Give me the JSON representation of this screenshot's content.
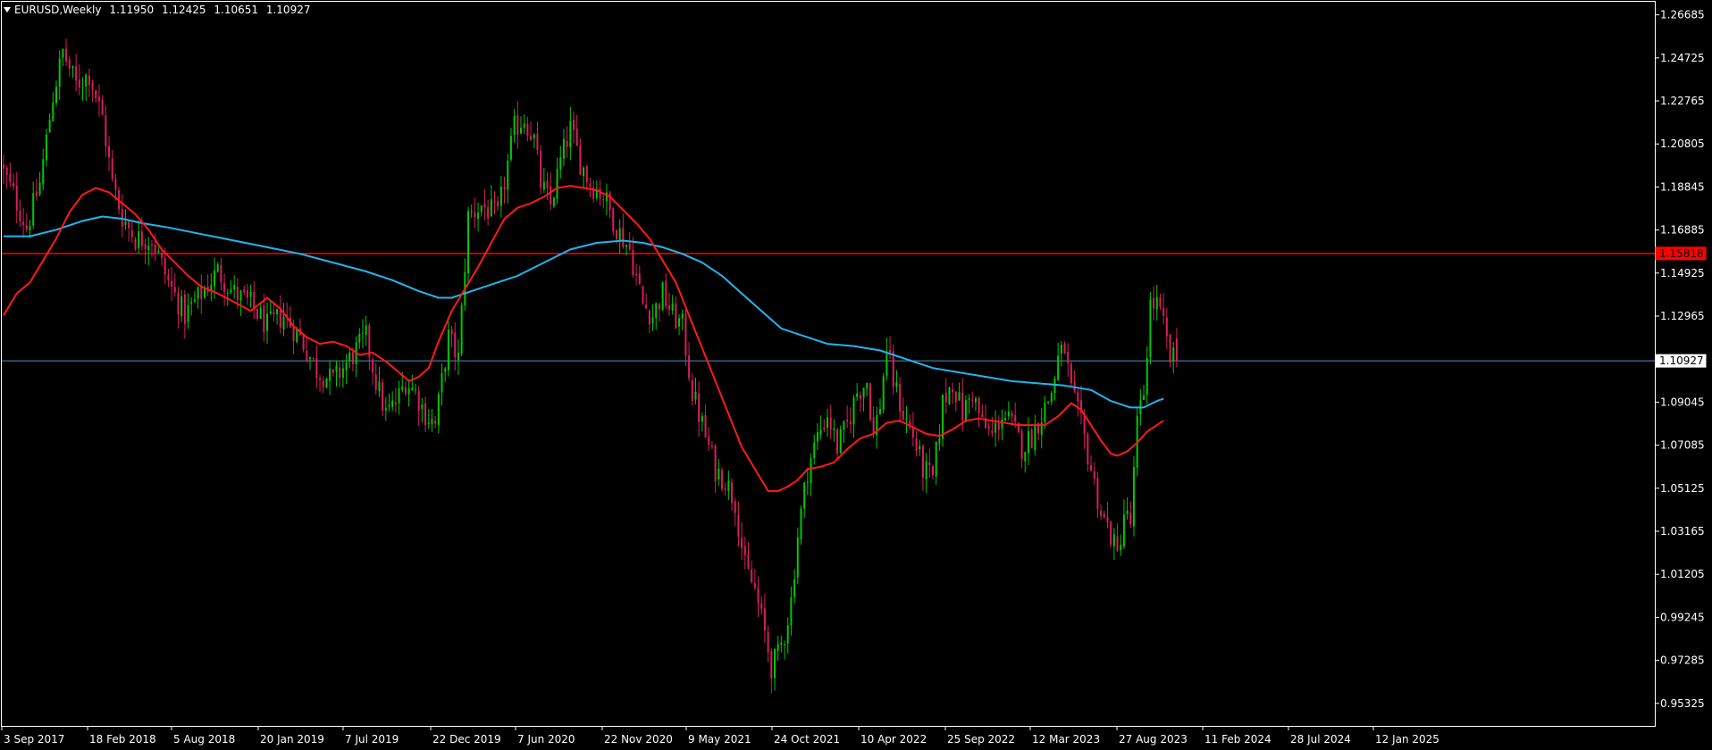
{
  "header": {
    "symbol_tf": "EURUSD,Weekly",
    "open": "1.11950",
    "high": "1.12425",
    "low": "1.10651",
    "close": "1.10927"
  },
  "colors": {
    "background": "#000000",
    "frame": "#ffffff",
    "bull": "#00c800",
    "bear": "#d81e5b",
    "ma_fast": "#ff1a1a",
    "ma_slow": "#22b5ec",
    "hline_red": "#ff0000",
    "hline_current": "#4f8fc0",
    "text": "#ffffff"
  },
  "chart_data": {
    "type": "candlestick",
    "symbol": "EURUSD",
    "timeframe": "Weekly",
    "ylim": [
      0.943,
      1.2728
    ],
    "y_ticks": [
      "1.26685",
      "1.24725",
      "1.22765",
      "1.20805",
      "1.18845",
      "1.16885",
      "1.14925",
      "1.12965",
      "1.11005",
      "1.09045",
      "1.07085",
      "1.05125",
      "1.03165",
      "1.01205",
      "0.99245",
      "0.97285",
      "0.95325"
    ],
    "x_ticks": [
      "3 Sep 2017",
      "18 Feb 2018",
      "5 Aug 2018",
      "20 Jan 2019",
      "7 Jul 2019",
      "22 Dec 2019",
      "7 Jun 2020",
      "22 Nov 2020",
      "9 May 2021",
      "24 Oct 2021",
      "10 Apr 2022",
      "25 Sep 2022",
      "12 Mar 2023",
      "27 Aug 2023",
      "11 Feb 2024",
      "28 Jul 2024",
      "12 Jan 2025"
    ],
    "horizontal_lines": [
      {
        "value": 1.15818,
        "label": "1.15818",
        "color": "#ff0000"
      },
      {
        "value": 1.10927,
        "label": "1.10927",
        "color": "#4f8fc0"
      }
    ],
    "close_anchors": [
      [
        0,
        1.195
      ],
      [
        3,
        1.185
      ],
      [
        7,
        1.17
      ],
      [
        11,
        1.19
      ],
      [
        15,
        1.23
      ],
      [
        18,
        1.25
      ],
      [
        22,
        1.235
      ],
      [
        26,
        1.24
      ],
      [
        30,
        1.22
      ],
      [
        33,
        1.19
      ],
      [
        36,
        1.175
      ],
      [
        40,
        1.165
      ],
      [
        45,
        1.165
      ],
      [
        50,
        1.145
      ],
      [
        55,
        1.13
      ],
      [
        60,
        1.14
      ],
      [
        65,
        1.15
      ],
      [
        70,
        1.14
      ],
      [
        75,
        1.135
      ],
      [
        80,
        1.125
      ],
      [
        85,
        1.13
      ],
      [
        90,
        1.12
      ],
      [
        95,
        1.105
      ],
      [
        100,
        1.1
      ],
      [
        105,
        1.11
      ],
      [
        110,
        1.12
      ],
      [
        113,
        1.1
      ],
      [
        116,
        1.085
      ],
      [
        119,
        1.09
      ],
      [
        122,
        1.1
      ],
      [
        125,
        1.095
      ],
      [
        128,
        1.085
      ],
      [
        131,
        1.08
      ],
      [
        135,
        1.12
      ],
      [
        138,
        1.11
      ],
      [
        141,
        1.175
      ],
      [
        145,
        1.18
      ],
      [
        150,
        1.175
      ],
      [
        155,
        1.215
      ],
      [
        158,
        1.22
      ],
      [
        161,
        1.21
      ],
      [
        163,
        1.19
      ],
      [
        166,
        1.18
      ],
      [
        169,
        1.2
      ],
      [
        172,
        1.215
      ],
      [
        175,
        1.2
      ],
      [
        178,
        1.19
      ],
      [
        182,
        1.185
      ],
      [
        186,
        1.17
      ],
      [
        190,
        1.16
      ],
      [
        194,
        1.135
      ],
      [
        197,
        1.13
      ],
      [
        200,
        1.14
      ],
      [
        203,
        1.13
      ],
      [
        206,
        1.125
      ],
      [
        209,
        1.095
      ],
      [
        213,
        1.075
      ],
      [
        216,
        1.06
      ],
      [
        219,
        1.055
      ],
      [
        222,
        1.045
      ],
      [
        225,
        1.015
      ],
      [
        228,
        1.005
      ],
      [
        231,
        0.985
      ],
      [
        233,
        0.97
      ],
      [
        235,
        0.975
      ],
      [
        237,
        0.985
      ],
      [
        239,
        1.0
      ],
      [
        241,
        1.03
      ],
      [
        244,
        1.06
      ],
      [
        247,
        1.075
      ],
      [
        250,
        1.085
      ],
      [
        253,
        1.07
      ],
      [
        256,
        1.08
      ],
      [
        259,
        1.095
      ],
      [
        262,
        1.1
      ],
      [
        264,
        1.075
      ],
      [
        266,
        1.09
      ],
      [
        268,
        1.115
      ],
      [
        270,
        1.1
      ],
      [
        273,
        1.085
      ],
      [
        276,
        1.075
      ],
      [
        279,
        1.06
      ],
      [
        282,
        1.055
      ],
      [
        285,
        1.09
      ],
      [
        288,
        1.1
      ],
      [
        291,
        1.085
      ],
      [
        294,
        1.095
      ],
      [
        297,
        1.08
      ],
      [
        300,
        1.075
      ],
      [
        303,
        1.085
      ],
      [
        306,
        1.08
      ],
      [
        309,
        1.07
      ],
      [
        312,
        1.075
      ],
      [
        315,
        1.085
      ],
      [
        318,
        1.095
      ],
      [
        320,
        1.11
      ],
      [
        322,
        1.115
      ],
      [
        324,
        1.095
      ],
      [
        327,
        1.08
      ],
      [
        330,
        1.06
      ],
      [
        333,
        1.04
      ],
      [
        336,
        1.03
      ],
      [
        338,
        1.02
      ],
      [
        340,
        1.04
      ],
      [
        342,
        1.035
      ],
      [
        344,
        1.08
      ],
      [
        346,
        1.095
      ],
      [
        348,
        1.135
      ],
      [
        350,
        1.135
      ],
      [
        352,
        1.125
      ],
      [
        354,
        1.11
      ]
    ],
    "ma_fast": {
      "name": "",
      "color": "#ff1a1a",
      "points": [
        [
          0,
          1.13
        ],
        [
          4,
          1.14
        ],
        [
          8,
          1.145
        ],
        [
          12,
          1.155
        ],
        [
          16,
          1.165
        ],
        [
          20,
          1.177
        ],
        [
          24,
          1.185
        ],
        [
          28,
          1.188
        ],
        [
          32,
          1.186
        ],
        [
          36,
          1.181
        ],
        [
          40,
          1.176
        ],
        [
          44,
          1.169
        ],
        [
          48,
          1.16
        ],
        [
          52,
          1.154
        ],
        [
          56,
          1.148
        ],
        [
          60,
          1.143
        ],
        [
          65,
          1.14
        ],
        [
          70,
          1.136
        ],
        [
          75,
          1.132
        ],
        [
          80,
          1.138
        ],
        [
          84,
          1.133
        ],
        [
          88,
          1.125
        ],
        [
          92,
          1.12
        ],
        [
          96,
          1.117
        ],
        [
          100,
          1.118
        ],
        [
          104,
          1.116
        ],
        [
          108,
          1.112
        ],
        [
          112,
          1.113
        ],
        [
          116,
          1.109
        ],
        [
          120,
          1.104
        ],
        [
          123,
          1.1
        ],
        [
          126,
          1.102
        ],
        [
          129,
          1.106
        ],
        [
          132,
          1.118
        ],
        [
          136,
          1.132
        ],
        [
          140,
          1.142
        ],
        [
          144,
          1.152
        ],
        [
          148,
          1.163
        ],
        [
          152,
          1.174
        ],
        [
          156,
          1.179
        ],
        [
          160,
          1.181
        ],
        [
          164,
          1.184
        ],
        [
          168,
          1.188
        ],
        [
          172,
          1.189
        ],
        [
          176,
          1.188
        ],
        [
          180,
          1.187
        ],
        [
          184,
          1.184
        ],
        [
          188,
          1.178
        ],
        [
          192,
          1.172
        ],
        [
          196,
          1.165
        ],
        [
          200,
          1.155
        ],
        [
          204,
          1.145
        ],
        [
          208,
          1.13
        ],
        [
          212,
          1.115
        ],
        [
          216,
          1.1
        ],
        [
          220,
          1.085
        ],
        [
          224,
          1.07
        ],
        [
          228,
          1.06
        ],
        [
          232,
          1.05
        ],
        [
          235,
          1.05
        ],
        [
          238,
          1.052
        ],
        [
          241,
          1.055
        ],
        [
          244,
          1.06
        ],
        [
          248,
          1.061
        ],
        [
          252,
          1.063
        ],
        [
          256,
          1.069
        ],
        [
          260,
          1.074
        ],
        [
          264,
          1.076
        ],
        [
          268,
          1.081
        ],
        [
          272,
          1.082
        ],
        [
          276,
          1.079
        ],
        [
          280,
          1.076
        ],
        [
          284,
          1.075
        ],
        [
          288,
          1.078
        ],
        [
          292,
          1.082
        ],
        [
          296,
          1.083
        ],
        [
          300,
          1.082
        ],
        [
          304,
          1.081
        ],
        [
          308,
          1.08
        ],
        [
          312,
          1.08
        ],
        [
          316,
          1.08
        ],
        [
          320,
          1.084
        ],
        [
          324,
          1.09
        ],
        [
          327,
          1.087
        ],
        [
          330,
          1.08
        ],
        [
          333,
          1.073
        ],
        [
          336,
          1.067
        ],
        [
          338,
          1.066
        ],
        [
          341,
          1.068
        ],
        [
          344,
          1.072
        ],
        [
          347,
          1.077
        ],
        [
          350,
          1.08
        ],
        [
          352,
          1.082
        ]
      ]
    },
    "ma_slow": {
      "name": "",
      "color": "#22b5ec",
      "points": [
        [
          0,
          1.166
        ],
        [
          8,
          1.166
        ],
        [
          16,
          1.169
        ],
        [
          24,
          1.173
        ],
        [
          30,
          1.175
        ],
        [
          36,
          1.174
        ],
        [
          42,
          1.172
        ],
        [
          50,
          1.17
        ],
        [
          60,
          1.167
        ],
        [
          70,
          1.164
        ],
        [
          80,
          1.161
        ],
        [
          90,
          1.158
        ],
        [
          100,
          1.154
        ],
        [
          110,
          1.15
        ],
        [
          118,
          1.146
        ],
        [
          126,
          1.141
        ],
        [
          132,
          1.138
        ],
        [
          136,
          1.138
        ],
        [
          140,
          1.14
        ],
        [
          148,
          1.144
        ],
        [
          156,
          1.148
        ],
        [
          164,
          1.154
        ],
        [
          172,
          1.16
        ],
        [
          180,
          1.163
        ],
        [
          188,
          1.164
        ],
        [
          194,
          1.163
        ],
        [
          200,
          1.161
        ],
        [
          206,
          1.158
        ],
        [
          212,
          1.154
        ],
        [
          218,
          1.148
        ],
        [
          224,
          1.14
        ],
        [
          230,
          1.132
        ],
        [
          236,
          1.124
        ],
        [
          242,
          1.121
        ],
        [
          250,
          1.117
        ],
        [
          258,
          1.116
        ],
        [
          266,
          1.114
        ],
        [
          274,
          1.11
        ],
        [
          282,
          1.106
        ],
        [
          290,
          1.104
        ],
        [
          298,
          1.102
        ],
        [
          306,
          1.1
        ],
        [
          314,
          1.099
        ],
        [
          322,
          1.098
        ],
        [
          330,
          1.096
        ],
        [
          336,
          1.091
        ],
        [
          342,
          1.088
        ],
        [
          346,
          1.088
        ],
        [
          350,
          1.091
        ],
        [
          352,
          1.092
        ]
      ]
    }
  }
}
